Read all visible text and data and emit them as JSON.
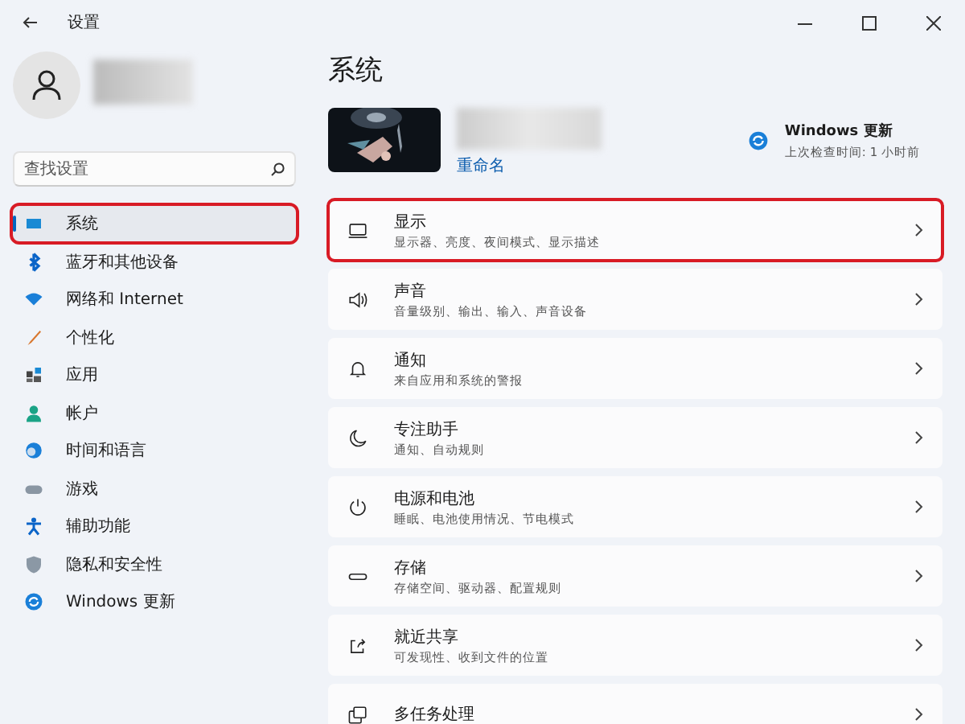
{
  "window": {
    "title": "设置"
  },
  "search": {
    "placeholder": "查找设置"
  },
  "sidebar": {
    "items": [
      {
        "label": "系统",
        "selected": true,
        "highlighted": true
      },
      {
        "label": "蓝牙和其他设备",
        "selected": false,
        "highlighted": false
      },
      {
        "label": "网络和 Internet",
        "selected": false,
        "highlighted": false
      },
      {
        "label": "个性化",
        "selected": false,
        "highlighted": false
      },
      {
        "label": "应用",
        "selected": false,
        "highlighted": false
      },
      {
        "label": "帐户",
        "selected": false,
        "highlighted": false
      },
      {
        "label": "时间和语言",
        "selected": false,
        "highlighted": false
      },
      {
        "label": "游戏",
        "selected": false,
        "highlighted": false
      },
      {
        "label": "辅助功能",
        "selected": false,
        "highlighted": false
      },
      {
        "label": "隐私和安全性",
        "selected": false,
        "highlighted": false
      },
      {
        "label": "Windows 更新",
        "selected": false,
        "highlighted": false
      }
    ]
  },
  "page_title": "系统",
  "device": {
    "rename_link": "重命名"
  },
  "update": {
    "title": "Windows 更新",
    "subtitle": "上次检查时间: 1 小时前"
  },
  "settings": [
    {
      "title": "显示",
      "subtitle": "显示器、亮度、夜间模式、显示描述",
      "highlighted": true
    },
    {
      "title": "声音",
      "subtitle": "音量级别、输出、输入、声音设备",
      "highlighted": false
    },
    {
      "title": "通知",
      "subtitle": "来自应用和系统的警报",
      "highlighted": false
    },
    {
      "title": "专注助手",
      "subtitle": "通知、自动规则",
      "highlighted": false
    },
    {
      "title": "电源和电池",
      "subtitle": "睡眠、电池使用情况、节电模式",
      "highlighted": false
    },
    {
      "title": "存储",
      "subtitle": "存储空间、驱动器、配置规则",
      "highlighted": false
    },
    {
      "title": "就近共享",
      "subtitle": "可发现性、收到文件的位置",
      "highlighted": false
    },
    {
      "title": "多任务处理",
      "highlighted": false
    }
  ]
}
